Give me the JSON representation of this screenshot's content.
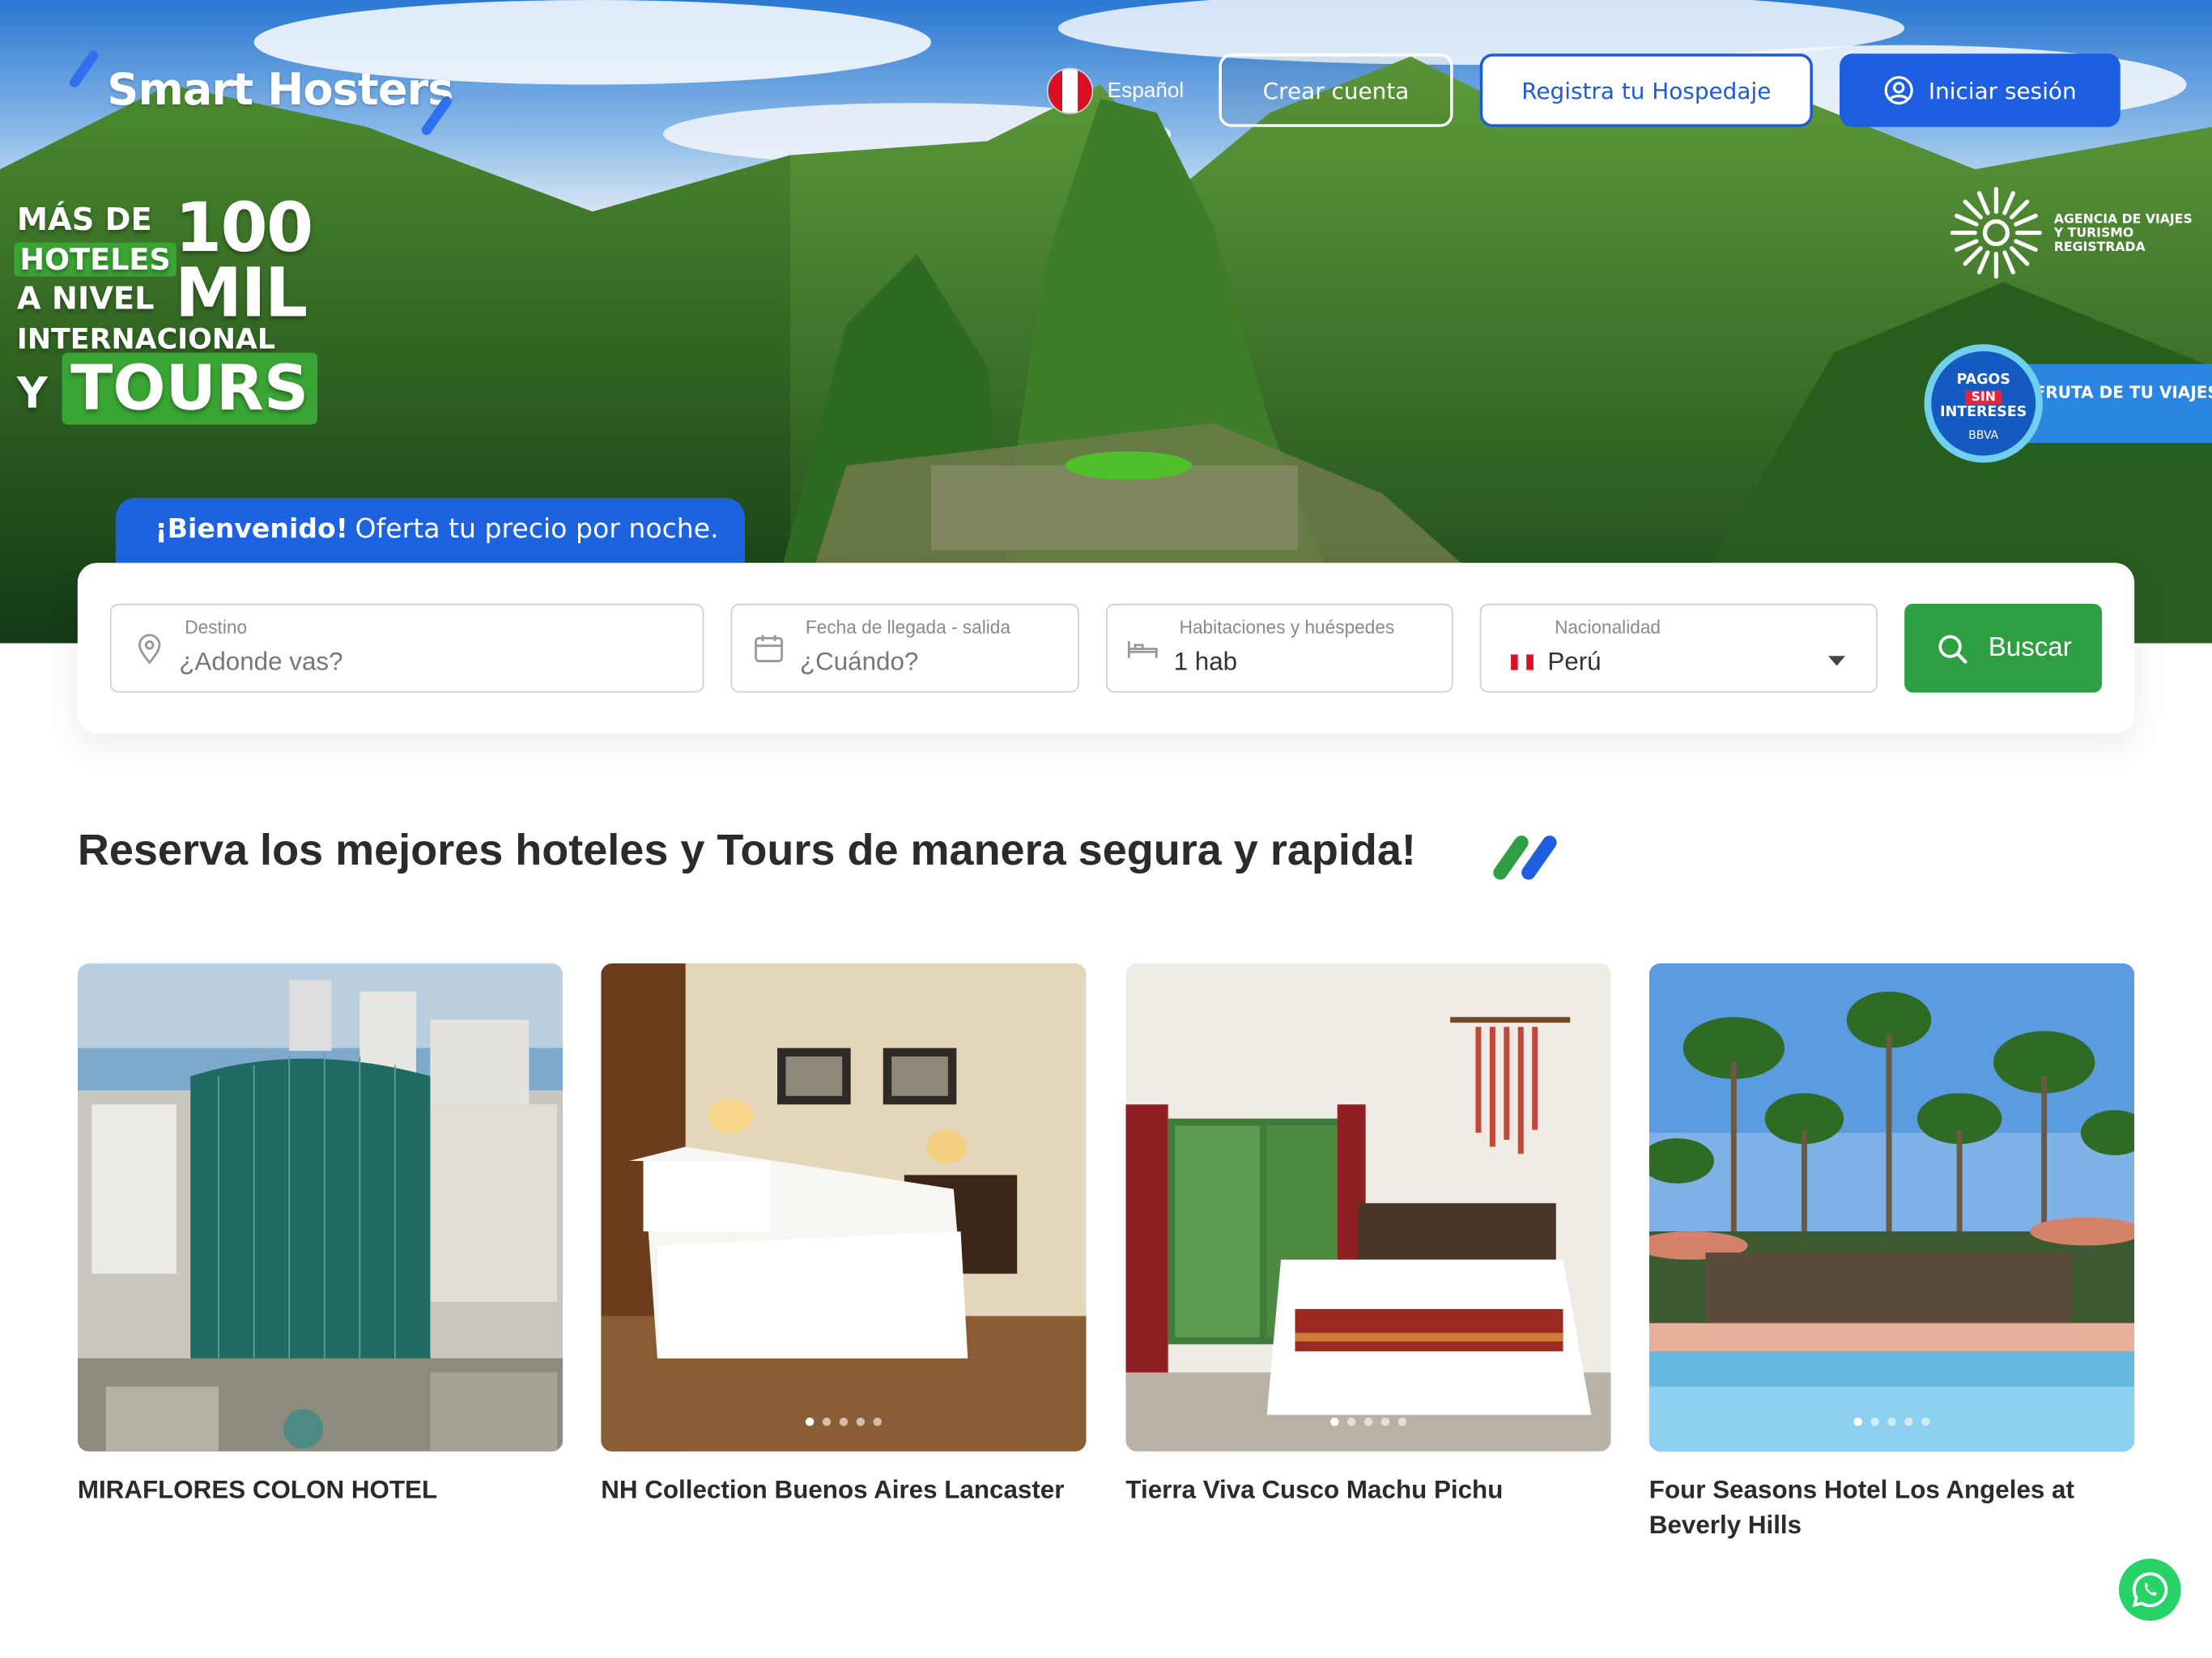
{
  "header": {
    "logo_text": "Smart Hosters",
    "language": "Español",
    "create_account": "Crear cuenta",
    "register_lodging": "Registra tu Hospedaje",
    "login": "Iniciar sesión"
  },
  "promo": {
    "line1": "MÁS DE",
    "line2": "HOTELES",
    "line3": "A NIVEL",
    "line4": "INTERNACIONAL",
    "big_number": "100",
    "big_unit": "MIL",
    "y": "Y",
    "tours": "TOURS"
  },
  "agency_badge": "AGENCIA DE VIAJES Y TURISMO REGISTRADA",
  "bbva_badge": {
    "line1": "PAGOS",
    "line2": "SIN",
    "line3": "INTERESES",
    "brand": "BBVA",
    "banner": "DISFRUTA DE TU VIAJES SIN LÍMITE"
  },
  "welcome": {
    "bold": "¡Bienvenido!",
    "text": "Oferta tu precio por noche."
  },
  "search": {
    "destination_label": "Destino",
    "destination_placeholder": "¿Adonde vas?",
    "date_label": "Fecha de llegada - salida",
    "date_placeholder": "¿Cuándo?",
    "rooms_label": "Habitaciones y huéspedes",
    "rooms_value": "1 hab",
    "nationality_label": "Nacionalidad",
    "nationality_value": "Perú",
    "button": "Buscar"
  },
  "section_title": "Reserva los mejores hoteles y Tours de manera segura y rapida!",
  "hotels": [
    {
      "name": "MIRAFLORES COLON HOTEL"
    },
    {
      "name": "NH Collection Buenos Aires Lancaster"
    },
    {
      "name": "Tierra Viva Cusco Machu Pichu"
    },
    {
      "name": "Four Seasons Hotel Los Angeles at Beverly Hills"
    }
  ],
  "colors": {
    "primary_blue": "#1d5fe0",
    "search_green": "#2ea043",
    "promo_green": "#3aa534",
    "flag_red": "#d91023"
  }
}
